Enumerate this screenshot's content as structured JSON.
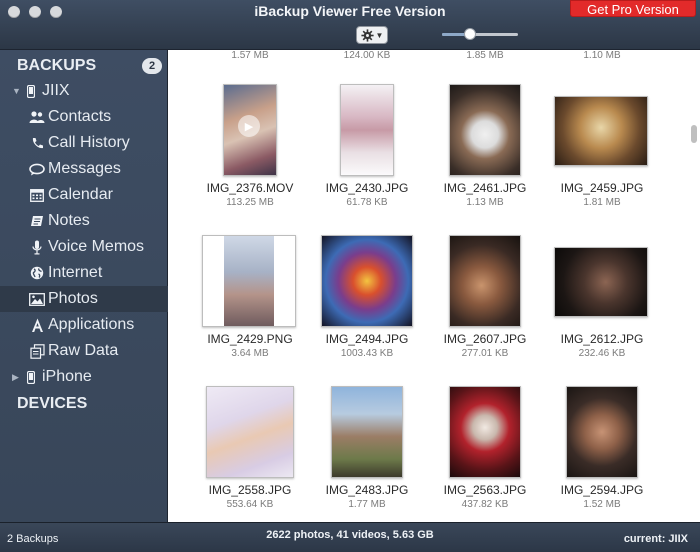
{
  "window": {
    "title": "iBackup Viewer Free Version",
    "pro_button": "Get Pro Version"
  },
  "toolbar": {
    "gear_icon": "gear-icon",
    "thumbnail_size": 0.37
  },
  "sidebar": {
    "backups_header": "BACKUPS",
    "backups_count": "2",
    "device": "JIIX",
    "items": [
      {
        "label": "Contacts",
        "icon": "contacts-icon"
      },
      {
        "label": "Call History",
        "icon": "phone-icon"
      },
      {
        "label": "Messages",
        "icon": "messages-icon"
      },
      {
        "label": "Calendar",
        "icon": "calendar-icon"
      },
      {
        "label": "Notes",
        "icon": "notes-icon"
      },
      {
        "label": "Voice Memos",
        "icon": "microphone-icon"
      },
      {
        "label": "Internet",
        "icon": "globe-icon"
      },
      {
        "label": "Photos",
        "icon": "photo-icon"
      },
      {
        "label": "Applications",
        "icon": "applications-icon"
      },
      {
        "label": "Raw Data",
        "icon": "raw-data-icon"
      }
    ],
    "device2": "iPhone",
    "devices_header": "DEVICES"
  },
  "content": {
    "top_sizes": [
      "1.57 MB",
      "124.00 KB",
      "1.85 MB",
      "1.10 MB"
    ],
    "photos": [
      {
        "name": "IMG_2376.MOV",
        "size": "113.25 MB"
      },
      {
        "name": "IMG_2430.JPG",
        "size": "61.78 KB"
      },
      {
        "name": "IMG_2461.JPG",
        "size": "1.13 MB"
      },
      {
        "name": "IMG_2459.JPG",
        "size": "1.81 MB"
      },
      {
        "name": "IMG_2429.PNG",
        "size": "3.64 MB"
      },
      {
        "name": "IMG_2494.JPG",
        "size": "1003.43 KB"
      },
      {
        "name": "IMG_2607.JPG",
        "size": "277.01 KB"
      },
      {
        "name": "IMG_2612.JPG",
        "size": "232.46 KB"
      },
      {
        "name": "IMG_2558.JPG",
        "size": "553.64 KB"
      },
      {
        "name": "IMG_2483.JPG",
        "size": "1.77 MB"
      },
      {
        "name": "IMG_2563.JPG",
        "size": "437.82 KB"
      },
      {
        "name": "IMG_2594.JPG",
        "size": "1.52 MB"
      }
    ]
  },
  "status": {
    "left": "2 Backups",
    "center": "2622 photos, 41 videos, 5.63 GB",
    "right": "current: JIIX"
  }
}
